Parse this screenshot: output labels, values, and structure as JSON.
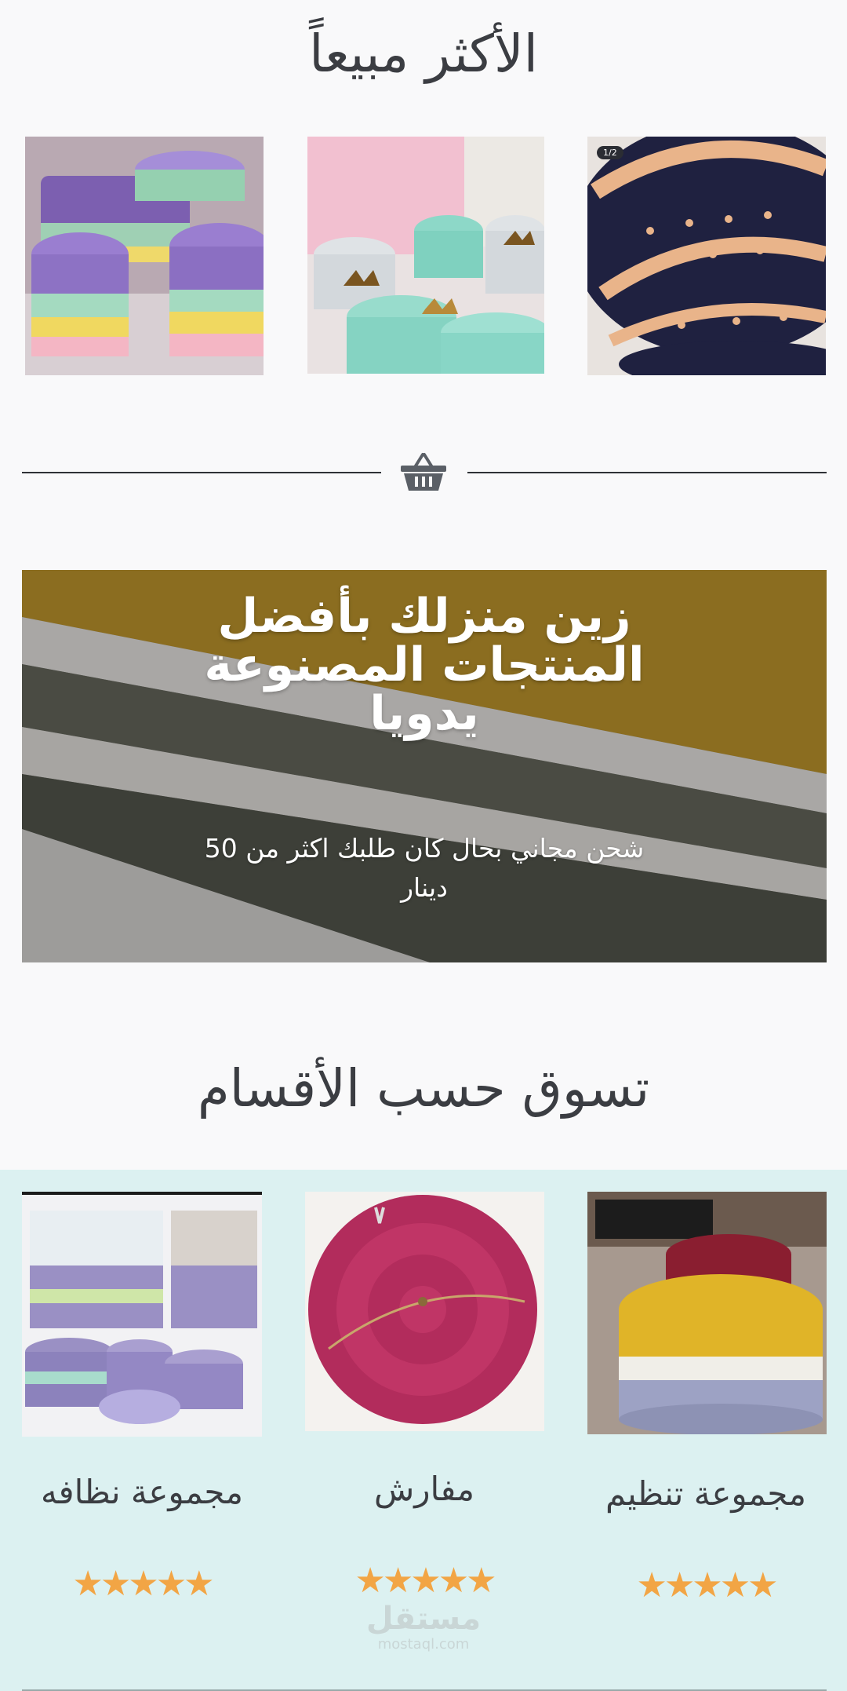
{
  "bestsellers": {
    "title": "الأكثر مبيعاً",
    "items": [
      {
        "image": "purple-rainbow-crochet-baskets",
        "badge": ""
      },
      {
        "image": "mint-crown-crochet-baskets",
        "badge": ""
      },
      {
        "image": "navy-peach-crochet-baskets",
        "badge": "1/2"
      }
    ]
  },
  "divider": {
    "icon": "basket-icon"
  },
  "banner": {
    "heading": "زين منزلك بأفضل المنتجات المصنوعة يدويا",
    "subtext": "شحن مجاني بحال كان طلبك اكثر من 50 دينار"
  },
  "categories": {
    "title": "تسوق حسب الأقسام",
    "items": [
      {
        "name": "مجموعة نظافه",
        "rating": 5,
        "stars": "★★★★★"
      },
      {
        "name": "مفارش",
        "rating": 5,
        "stars": "★★★★★"
      },
      {
        "name": "مجموعة تنظيم",
        "rating": 5,
        "stars": "★★★★★"
      }
    ]
  },
  "watermark": {
    "main": "مستقل",
    "sub": "mostaql.com"
  },
  "colors": {
    "accent_star": "#f2a545",
    "category_bg": "#dcf1f1",
    "page_bg": "#f9f9fa"
  }
}
